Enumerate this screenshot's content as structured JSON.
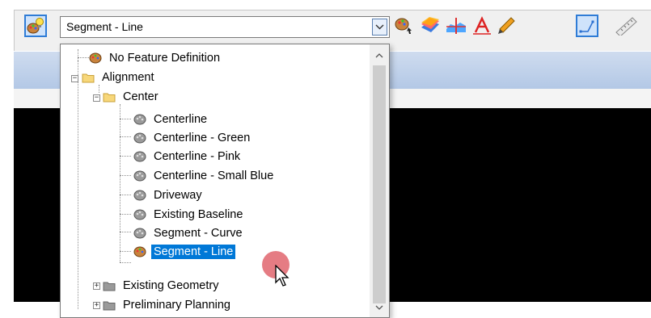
{
  "combo": {
    "value": "Segment - Line"
  },
  "tree": {
    "items": [
      {
        "label": "No Feature Definition"
      },
      {
        "label": "Alignment"
      },
      {
        "label": "Center"
      },
      {
        "label": "Centerline"
      },
      {
        "label": "Centerline - Green"
      },
      {
        "label": "Centerline - Pink"
      },
      {
        "label": "Centerline - Small Blue"
      },
      {
        "label": "Driveway"
      },
      {
        "label": "Existing Baseline"
      },
      {
        "label": "Segment - Curve"
      },
      {
        "label": "Segment - Line"
      },
      {
        "label": "Existing Geometry"
      },
      {
        "label": "Preliminary Planning"
      }
    ],
    "selected_index": 10
  },
  "icons": {
    "match_tool": "palette-lightbulb-icon",
    "feature_pick": "palette-pick-icon",
    "surface": "surface-layers-icon",
    "profile": "profile-cross-icon",
    "text": "text-a-icon",
    "pen": "pen-icon",
    "segment": "segment-path-icon",
    "ruler": "ruler-icon",
    "folder": "folder-icon",
    "feature": "palette-icon"
  },
  "colors": {
    "selection": "#0078d7",
    "active_tool_border": "#2f7cd6",
    "canvas": "#000000",
    "header_band": "#b3c8e6"
  }
}
